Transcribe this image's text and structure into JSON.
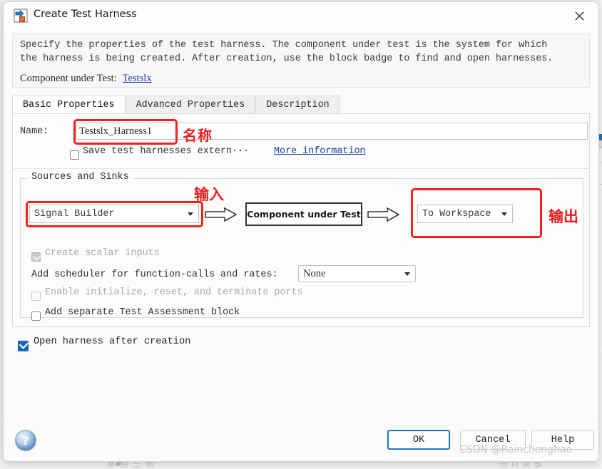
{
  "window": {
    "title": "Create Test Harness",
    "icon": "simulink-harness-icon",
    "close_icon": "close-icon"
  },
  "description": {
    "line1": "Specify the properties of the test harness. The component under test is the system for which",
    "line2": "the harness is being created. After creation, use the block badge to find and open harnesses.",
    "cut_label": "Component under Test:",
    "cut_link": "Testslx"
  },
  "tabs": [
    {
      "label": "Basic Properties",
      "active": true
    },
    {
      "label": "Advanced Properties",
      "active": false
    },
    {
      "label": "Description",
      "active": false
    }
  ],
  "basic": {
    "name_label": "Name:",
    "name_value": "Testslx_Harness1",
    "name_placeholder": "",
    "annotation_name": "名称",
    "save_extern_label": "Save test harnesses extern···",
    "more_information": "More information"
  },
  "sources_sinks": {
    "group_title": "Sources and Sinks",
    "source_value": "Signal Builder",
    "cut_block_label": "Component under Test",
    "sink_value": "To Workspace",
    "annotation_input": "输入",
    "annotation_output": "输出",
    "scalar_inputs_label": "Create scalar inputs",
    "scheduler_label": "Add scheduler for function-calls and rates:",
    "scheduler_value": "None",
    "enable_ports_label": "Enable initialize, reset, and terminate ports",
    "assessment_label": "Add separate Test Assessment block"
  },
  "open_harness_label": "Open harness after creation",
  "footer": {
    "help_orb": "?",
    "ok": "OK",
    "cancel": "Cancel",
    "help": "Help"
  },
  "watermark": "CSDN @Rainchenghao",
  "background": {
    "bottom_text": "蔡徐三师",
    "bottom_text2": "得点前事"
  },
  "colors": {
    "annotation_red": "#ec2020",
    "link_blue": "#1a3fa0",
    "accent_blue": "#1d76c4",
    "checkbox_blue": "#1666b0"
  }
}
